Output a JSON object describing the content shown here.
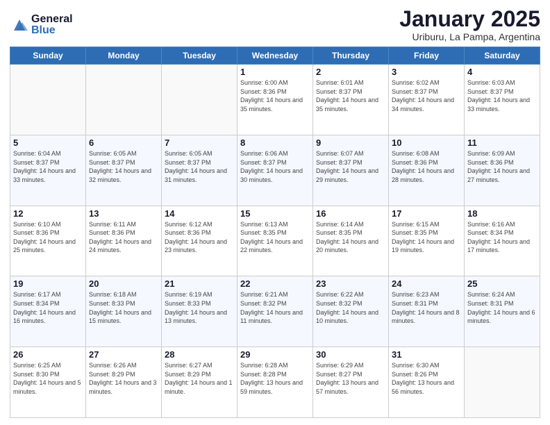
{
  "header": {
    "logo_general": "General",
    "logo_blue": "Blue",
    "month_title": "January 2025",
    "location": "Uriburu, La Pampa, Argentina"
  },
  "weekdays": [
    "Sunday",
    "Monday",
    "Tuesday",
    "Wednesday",
    "Thursday",
    "Friday",
    "Saturday"
  ],
  "weeks": [
    [
      {
        "day": "",
        "sunrise": "",
        "sunset": "",
        "daylight": ""
      },
      {
        "day": "",
        "sunrise": "",
        "sunset": "",
        "daylight": ""
      },
      {
        "day": "",
        "sunrise": "",
        "sunset": "",
        "daylight": ""
      },
      {
        "day": "1",
        "sunrise": "Sunrise: 6:00 AM",
        "sunset": "Sunset: 8:36 PM",
        "daylight": "Daylight: 14 hours and 35 minutes."
      },
      {
        "day": "2",
        "sunrise": "Sunrise: 6:01 AM",
        "sunset": "Sunset: 8:37 PM",
        "daylight": "Daylight: 14 hours and 35 minutes."
      },
      {
        "day": "3",
        "sunrise": "Sunrise: 6:02 AM",
        "sunset": "Sunset: 8:37 PM",
        "daylight": "Daylight: 14 hours and 34 minutes."
      },
      {
        "day": "4",
        "sunrise": "Sunrise: 6:03 AM",
        "sunset": "Sunset: 8:37 PM",
        "daylight": "Daylight: 14 hours and 33 minutes."
      }
    ],
    [
      {
        "day": "5",
        "sunrise": "Sunrise: 6:04 AM",
        "sunset": "Sunset: 8:37 PM",
        "daylight": "Daylight: 14 hours and 33 minutes."
      },
      {
        "day": "6",
        "sunrise": "Sunrise: 6:05 AM",
        "sunset": "Sunset: 8:37 PM",
        "daylight": "Daylight: 14 hours and 32 minutes."
      },
      {
        "day": "7",
        "sunrise": "Sunrise: 6:05 AM",
        "sunset": "Sunset: 8:37 PM",
        "daylight": "Daylight: 14 hours and 31 minutes."
      },
      {
        "day": "8",
        "sunrise": "Sunrise: 6:06 AM",
        "sunset": "Sunset: 8:37 PM",
        "daylight": "Daylight: 14 hours and 30 minutes."
      },
      {
        "day": "9",
        "sunrise": "Sunrise: 6:07 AM",
        "sunset": "Sunset: 8:37 PM",
        "daylight": "Daylight: 14 hours and 29 minutes."
      },
      {
        "day": "10",
        "sunrise": "Sunrise: 6:08 AM",
        "sunset": "Sunset: 8:36 PM",
        "daylight": "Daylight: 14 hours and 28 minutes."
      },
      {
        "day": "11",
        "sunrise": "Sunrise: 6:09 AM",
        "sunset": "Sunset: 8:36 PM",
        "daylight": "Daylight: 14 hours and 27 minutes."
      }
    ],
    [
      {
        "day": "12",
        "sunrise": "Sunrise: 6:10 AM",
        "sunset": "Sunset: 8:36 PM",
        "daylight": "Daylight: 14 hours and 25 minutes."
      },
      {
        "day": "13",
        "sunrise": "Sunrise: 6:11 AM",
        "sunset": "Sunset: 8:36 PM",
        "daylight": "Daylight: 14 hours and 24 minutes."
      },
      {
        "day": "14",
        "sunrise": "Sunrise: 6:12 AM",
        "sunset": "Sunset: 8:36 PM",
        "daylight": "Daylight: 14 hours and 23 minutes."
      },
      {
        "day": "15",
        "sunrise": "Sunrise: 6:13 AM",
        "sunset": "Sunset: 8:35 PM",
        "daylight": "Daylight: 14 hours and 22 minutes."
      },
      {
        "day": "16",
        "sunrise": "Sunrise: 6:14 AM",
        "sunset": "Sunset: 8:35 PM",
        "daylight": "Daylight: 14 hours and 20 minutes."
      },
      {
        "day": "17",
        "sunrise": "Sunrise: 6:15 AM",
        "sunset": "Sunset: 8:35 PM",
        "daylight": "Daylight: 14 hours and 19 minutes."
      },
      {
        "day": "18",
        "sunrise": "Sunrise: 6:16 AM",
        "sunset": "Sunset: 8:34 PM",
        "daylight": "Daylight: 14 hours and 17 minutes."
      }
    ],
    [
      {
        "day": "19",
        "sunrise": "Sunrise: 6:17 AM",
        "sunset": "Sunset: 8:34 PM",
        "daylight": "Daylight: 14 hours and 16 minutes."
      },
      {
        "day": "20",
        "sunrise": "Sunrise: 6:18 AM",
        "sunset": "Sunset: 8:33 PM",
        "daylight": "Daylight: 14 hours and 15 minutes."
      },
      {
        "day": "21",
        "sunrise": "Sunrise: 6:19 AM",
        "sunset": "Sunset: 8:33 PM",
        "daylight": "Daylight: 14 hours and 13 minutes."
      },
      {
        "day": "22",
        "sunrise": "Sunrise: 6:21 AM",
        "sunset": "Sunset: 8:32 PM",
        "daylight": "Daylight: 14 hours and 11 minutes."
      },
      {
        "day": "23",
        "sunrise": "Sunrise: 6:22 AM",
        "sunset": "Sunset: 8:32 PM",
        "daylight": "Daylight: 14 hours and 10 minutes."
      },
      {
        "day": "24",
        "sunrise": "Sunrise: 6:23 AM",
        "sunset": "Sunset: 8:31 PM",
        "daylight": "Daylight: 14 hours and 8 minutes."
      },
      {
        "day": "25",
        "sunrise": "Sunrise: 6:24 AM",
        "sunset": "Sunset: 8:31 PM",
        "daylight": "Daylight: 14 hours and 6 minutes."
      }
    ],
    [
      {
        "day": "26",
        "sunrise": "Sunrise: 6:25 AM",
        "sunset": "Sunset: 8:30 PM",
        "daylight": "Daylight: 14 hours and 5 minutes."
      },
      {
        "day": "27",
        "sunrise": "Sunrise: 6:26 AM",
        "sunset": "Sunset: 8:29 PM",
        "daylight": "Daylight: 14 hours and 3 minutes."
      },
      {
        "day": "28",
        "sunrise": "Sunrise: 6:27 AM",
        "sunset": "Sunset: 8:29 PM",
        "daylight": "Daylight: 14 hours and 1 minute."
      },
      {
        "day": "29",
        "sunrise": "Sunrise: 6:28 AM",
        "sunset": "Sunset: 8:28 PM",
        "daylight": "Daylight: 13 hours and 59 minutes."
      },
      {
        "day": "30",
        "sunrise": "Sunrise: 6:29 AM",
        "sunset": "Sunset: 8:27 PM",
        "daylight": "Daylight: 13 hours and 57 minutes."
      },
      {
        "day": "31",
        "sunrise": "Sunrise: 6:30 AM",
        "sunset": "Sunset: 8:26 PM",
        "daylight": "Daylight: 13 hours and 56 minutes."
      },
      {
        "day": "",
        "sunrise": "",
        "sunset": "",
        "daylight": ""
      }
    ]
  ]
}
